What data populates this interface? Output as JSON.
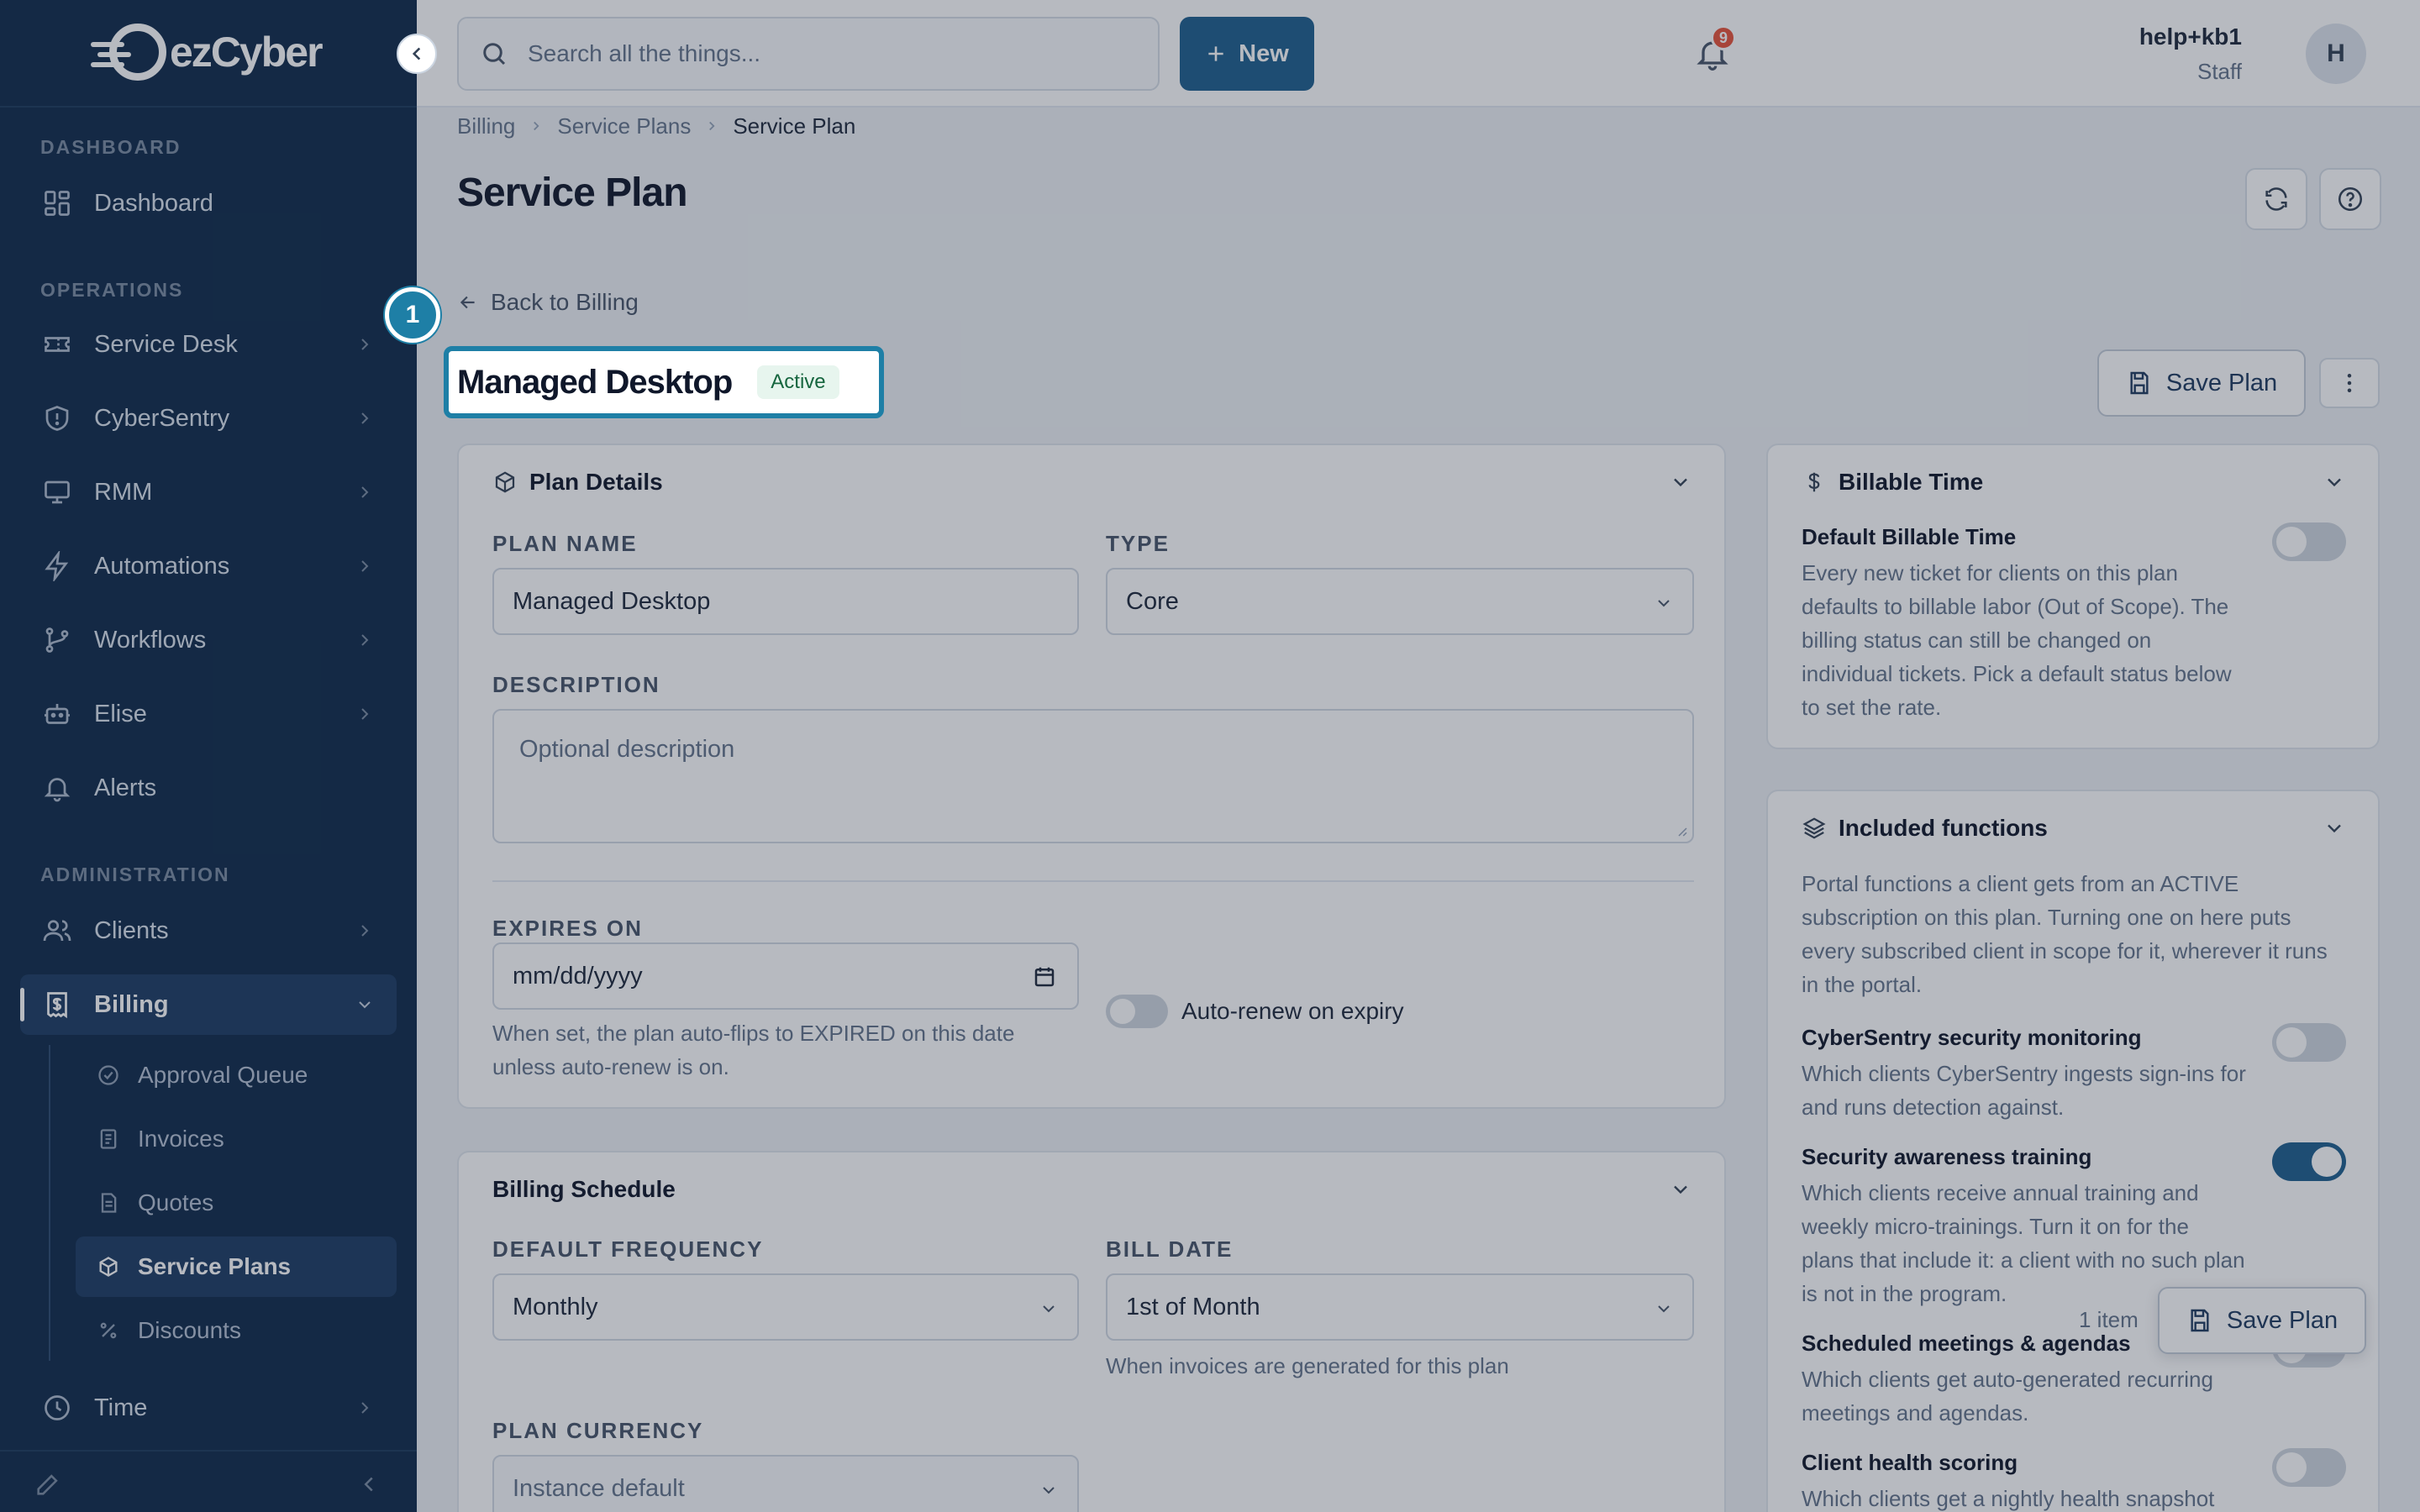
{
  "app": {
    "logo_text_ez": "ez",
    "logo_text_cyber": "Cyber"
  },
  "sidebar": {
    "sections": {
      "dashboard": "DASHBOARD",
      "operations": "OPERATIONS",
      "administration": "ADMINISTRATION"
    },
    "items": {
      "dashboard": "Dashboard",
      "service_desk": "Service Desk",
      "cybersentry": "CyberSentry",
      "rmm": "RMM",
      "automations": "Automations",
      "workflows": "Workflows",
      "elise": "Elise",
      "alerts": "Alerts",
      "clients": "Clients",
      "billing": "Billing",
      "time": "Time"
    },
    "billing_sub": {
      "approval_queue": "Approval Queue",
      "invoices": "Invoices",
      "quotes": "Quotes",
      "service_plans": "Service Plans",
      "discounts": "Discounts"
    }
  },
  "header": {
    "search_placeholder": "Search all the things...",
    "new_label": "New",
    "notification_count": "9",
    "user_name": "help+kb1",
    "user_role": "Staff",
    "avatar_initial": "H"
  },
  "breadcrumb": {
    "items": [
      "Billing",
      "Service Plans",
      "Service Plan"
    ]
  },
  "page": {
    "title": "Service Plan",
    "back_label": "Back to Billing",
    "plan_name": "Managed Desktop",
    "status": "Active",
    "save_label": "Save Plan",
    "step_number": "1"
  },
  "plan_details": {
    "title": "Plan Details",
    "plan_name_label": "PLAN NAME",
    "plan_name_value": "Managed Desktop",
    "type_label": "TYPE",
    "type_value": "Core",
    "description_label": "DESCRIPTION",
    "description_placeholder": "Optional description",
    "expires_label": "EXPIRES ON",
    "expires_placeholder": "mm/dd/yyyy",
    "expires_help_1": "When set, the plan auto-flips to EXPIRED on this date",
    "expires_help_2": "unless auto-renew is on.",
    "auto_renew_label": "Auto-renew on expiry",
    "auto_renew_on": false
  },
  "billing_schedule": {
    "title": "Billing Schedule",
    "frequency_label": "DEFAULT FREQUENCY",
    "frequency_value": "Monthly",
    "bill_date_label": "BILL DATE",
    "bill_date_value": "1st of Month",
    "bill_date_help": "When invoices are generated for this plan",
    "currency_label": "PLAN CURRENCY",
    "currency_value": "Instance default"
  },
  "billable_time": {
    "title": "Billable Time",
    "default_title": "Default Billable Time",
    "default_desc": [
      "Every new ticket for clients on this plan",
      "defaults to billable labor (Out of Scope). The",
      "billing status can still be changed on",
      "individual tickets. Pick a default status below",
      "to set the rate."
    ],
    "default_on": false
  },
  "included_functions": {
    "title": "Included functions",
    "intro": [
      "Portal functions a client gets from an ACTIVE",
      "subscription on this plan. Turning one on here puts",
      "every subscribed client in scope for it, wherever it runs",
      "in the portal."
    ],
    "items": [
      {
        "title": "CyberSentry security monitoring",
        "desc": [
          "Which clients CyberSentry ingests sign-ins for",
          "and runs detection against."
        ],
        "on": false
      },
      {
        "title": "Security awareness training",
        "desc": [
          "Which clients receive annual training and",
          "weekly micro-trainings. Turn it on for the",
          "plans that include it: a client with no such plan",
          "is not in the program."
        ],
        "on": true
      },
      {
        "title": "Scheduled meetings & agendas",
        "desc": [
          "Which clients get auto-generated recurring",
          "meetings and agendas."
        ],
        "on": false
      },
      {
        "title": "Client health scoring",
        "desc": [
          "Which clients get a nightly health snapshot"
        ],
        "on": false
      }
    ]
  },
  "floating_bar": {
    "count": "1 item",
    "save_label": "Save Plan"
  }
}
